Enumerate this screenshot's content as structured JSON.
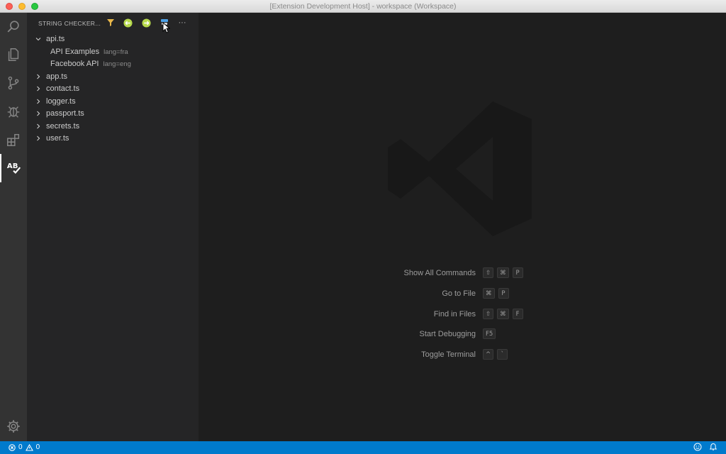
{
  "window": {
    "title": "[Extension Development Host] - workspace (Workspace)"
  },
  "activity_bar": {
    "items": [
      "search",
      "explorer",
      "source-control",
      "debug",
      "extensions",
      "string-checker"
    ],
    "string_checker_icon_text": "AB",
    "accent": "#ffffff"
  },
  "sidebar": {
    "title": "STRING CHECKER...",
    "toolbar": [
      "filter-icon",
      "prev-icon",
      "next-icon",
      "refresh-icon",
      "more-icon"
    ],
    "more_glyph": "···",
    "tree": [
      {
        "label": "api.ts",
        "expanded": true,
        "children": [
          {
            "label": "API Examples",
            "desc": "lang=fra"
          },
          {
            "label": "Facebook API",
            "desc": "lang=eng"
          }
        ]
      },
      {
        "label": "app.ts",
        "expanded": false
      },
      {
        "label": "contact.ts",
        "expanded": false
      },
      {
        "label": "logger.ts",
        "expanded": false
      },
      {
        "label": "passport.ts",
        "expanded": false
      },
      {
        "label": "secrets.ts",
        "expanded": false
      },
      {
        "label": "user.ts",
        "expanded": false
      }
    ]
  },
  "editor": {
    "shortcuts": [
      {
        "label": "Show All Commands",
        "keys": [
          "⇧",
          "⌘",
          "P"
        ]
      },
      {
        "label": "Go to File",
        "keys": [
          "⌘",
          "P"
        ]
      },
      {
        "label": "Find in Files",
        "keys": [
          "⇧",
          "⌘",
          "F"
        ]
      },
      {
        "label": "Start Debugging",
        "keys": [
          "F5"
        ]
      },
      {
        "label": "Toggle Terminal",
        "keys": [
          "^",
          "`"
        ]
      }
    ]
  },
  "status_bar": {
    "errors": "0",
    "warnings": "0",
    "color": "#007acc"
  }
}
